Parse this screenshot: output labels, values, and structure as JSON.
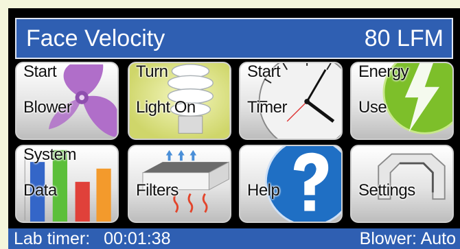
{
  "header": {
    "title": "Face Velocity",
    "value": "80 LFM"
  },
  "tiles": [
    {
      "line1": "Start",
      "line2": "Blower",
      "icon": "fan-icon"
    },
    {
      "line1": "Turn",
      "line2": "Light On",
      "icon": "light-bulb-icon"
    },
    {
      "line1": "Start",
      "line2": "Timer",
      "icon": "clock-icon"
    },
    {
      "line1": "Energy",
      "line2": "Use",
      "icon": "lightning-icon"
    },
    {
      "line1": "System",
      "line2": "Data",
      "icon": "bar-chart-icon"
    },
    {
      "line1": "Filters",
      "line2": "",
      "icon": "filter-icon"
    },
    {
      "line1": "Help",
      "line2": "",
      "icon": "question-mark-icon"
    },
    {
      "line1": "Settings",
      "line2": "",
      "icon": "wrench-icon"
    }
  ],
  "status": {
    "lab_timer_label": "Lab timer:",
    "lab_timer_value": "00:01:38",
    "blower_status": "Blower: Auto"
  },
  "colors": {
    "header_bg": "#2f5fb2",
    "screen_bg": "#000000",
    "fan": "#b06ec9",
    "energy": "#7dbf2a",
    "help": "#1f6fc4"
  }
}
